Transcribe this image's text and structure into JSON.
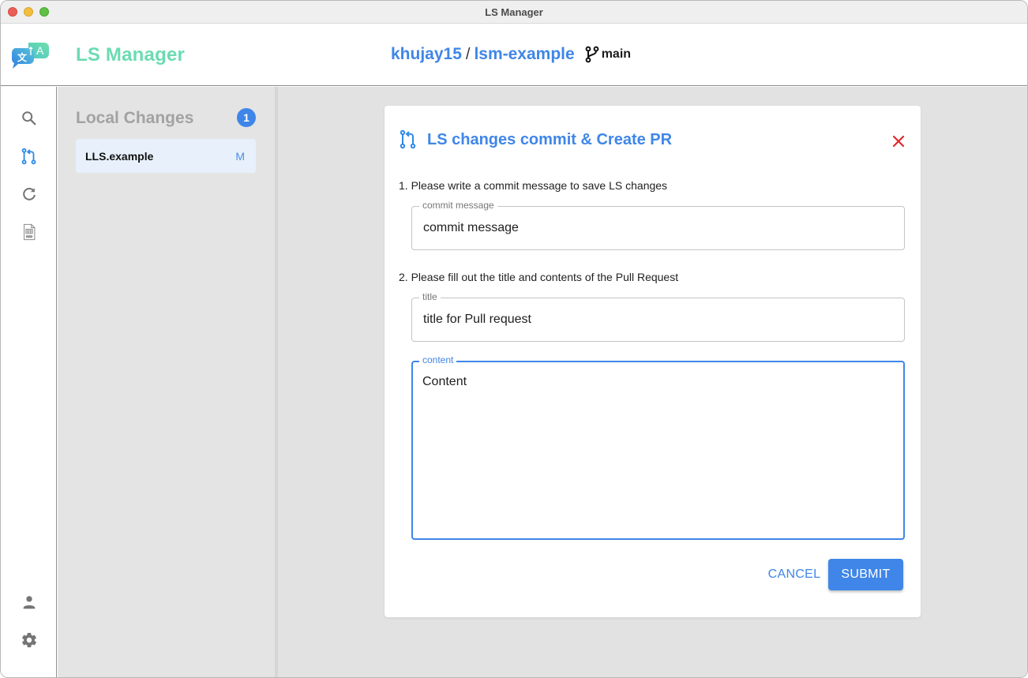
{
  "window": {
    "title": "LS Manager"
  },
  "header": {
    "app_name": "LS Manager",
    "repo_owner": "khujay15",
    "repo_separator": "/",
    "repo_name": "lsm-example",
    "branch": "main",
    "logo_icon": "translate-chat-icon",
    "branch_icon": "git-branch-icon"
  },
  "sidebar": {
    "items": [
      {
        "name": "search",
        "icon": "search-icon",
        "active": false
      },
      {
        "name": "pull-request",
        "icon": "git-pull-request-icon",
        "active": true
      },
      {
        "name": "refresh",
        "icon": "refresh-icon",
        "active": false
      },
      {
        "name": "xls-file",
        "icon": "xls-file-icon",
        "active": false
      }
    ],
    "bottom_items": [
      {
        "name": "account",
        "icon": "person-icon"
      },
      {
        "name": "settings",
        "icon": "gear-icon"
      }
    ]
  },
  "changes_panel": {
    "title": "Local Changes",
    "count": "1",
    "items": [
      {
        "file": "LLS.example",
        "status": "M"
      }
    ]
  },
  "dialog": {
    "title": "LS changes commit & Create PR",
    "title_icon": "git-pull-request-icon",
    "close_icon": "close-icon",
    "step1": "1. Please write a commit message to save LS changes",
    "step2": "2. Please fill out the title and contents of the Pull Request",
    "commit_field": {
      "label": "commit message",
      "value": "commit message"
    },
    "title_field": {
      "label": "title",
      "value": "title for Pull request"
    },
    "content_field": {
      "label": "content",
      "value": "Content"
    },
    "cancel_label": "CANCEL",
    "submit_label": "SUBMIT"
  },
  "colors": {
    "accent": "#3f86e8",
    "brand": "#6bdbb2",
    "close": "#e0282c"
  }
}
